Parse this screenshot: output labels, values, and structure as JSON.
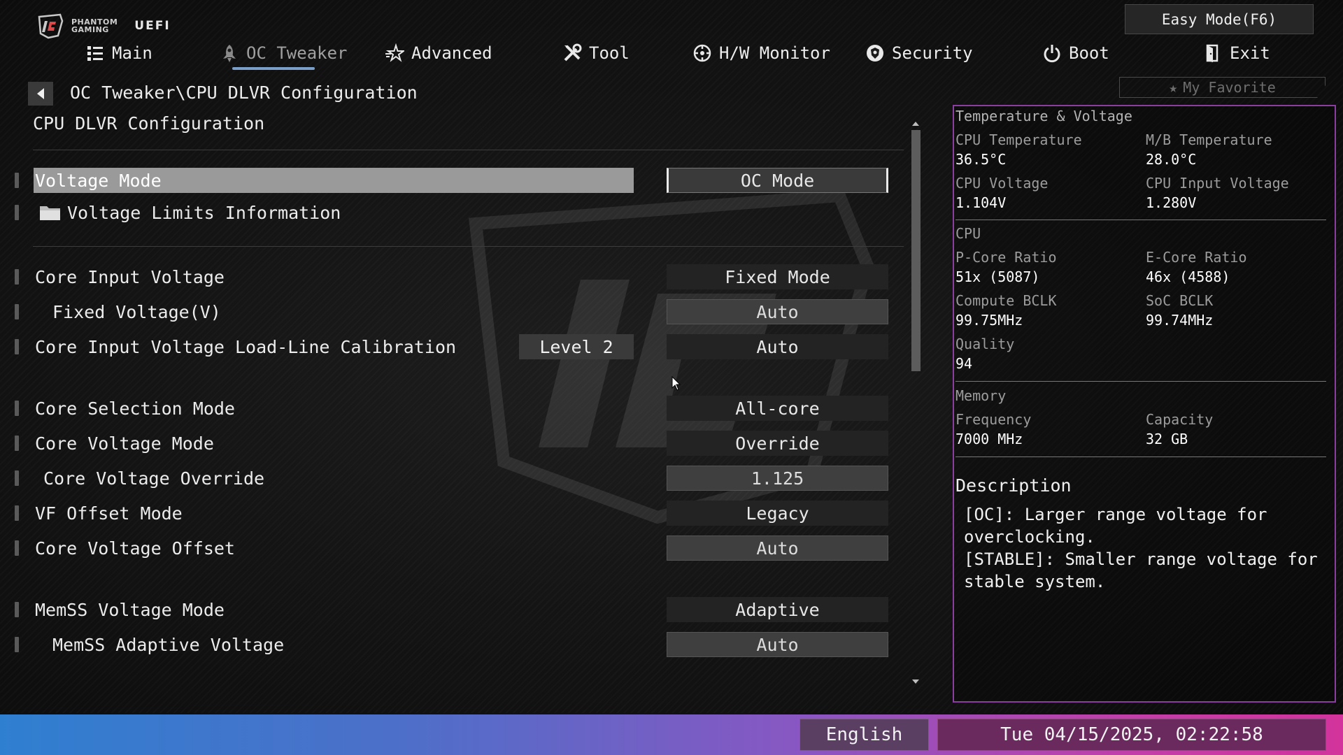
{
  "header": {
    "brand_line1": "PHANTOM",
    "brand_line2": "GAMING",
    "brand_uefi": "UEFI",
    "easy_mode": "Easy Mode(F6)",
    "my_favorite": "My Favorite"
  },
  "tabs": [
    {
      "label": "Main",
      "icon": "list-icon"
    },
    {
      "label": "OC Tweaker",
      "icon": "rocket-icon",
      "active": true
    },
    {
      "label": "Advanced",
      "icon": "star-icon"
    },
    {
      "label": "Tool",
      "icon": "tools-icon"
    },
    {
      "label": "H/W Monitor",
      "icon": "monitor-icon"
    },
    {
      "label": "Security",
      "icon": "shield-icon"
    },
    {
      "label": "Boot",
      "icon": "power-icon"
    },
    {
      "label": "Exit",
      "icon": "exit-icon"
    }
  ],
  "breadcrumb": "OC Tweaker\\CPU DLVR Configuration",
  "page_title": "CPU DLVR Configuration",
  "settings": [
    {
      "label": "Voltage Mode",
      "value": "OC Mode"
    },
    {
      "label": "Voltage Limits Information"
    },
    {
      "label": "Core Input Voltage",
      "value": "Fixed Mode"
    },
    {
      "label": "Fixed Voltage(V)",
      "value": "Auto"
    },
    {
      "label": "Core Input Voltage Load-Line Calibration",
      "hint": "Level 2",
      "value": "Auto"
    },
    {
      "label": "Core Selection Mode",
      "value": "All-core"
    },
    {
      "label": "Core Voltage Mode",
      "value": "Override"
    },
    {
      "label": "Core Voltage Override",
      "value": "1.125"
    },
    {
      "label": "VF Offset Mode",
      "value": "Legacy"
    },
    {
      "label": "Core Voltage Offset",
      "value": "Auto"
    },
    {
      "label": "MemSS Voltage Mode",
      "value": "Adaptive"
    },
    {
      "label": "MemSS Adaptive Voltage",
      "value": "Auto"
    }
  ],
  "panel": {
    "title": "Temperature & Voltage",
    "cpu_temp_label": "CPU Temperature",
    "cpu_temp": "36.5°C",
    "mb_temp_label": "M/B Temperature",
    "mb_temp": "28.0°C",
    "cpu_voltage_label": "CPU Voltage",
    "cpu_voltage": "1.104V",
    "cpu_input_voltage_label": "CPU Input Voltage",
    "cpu_input_voltage": "1.280V",
    "cpu_section": "CPU",
    "pcore_label": "P-Core Ratio",
    "pcore": "51x (5087)",
    "ecore_label": "E-Core Ratio",
    "ecore": "46x (4588)",
    "compute_bclk_label": "Compute BCLK",
    "compute_bclk": "99.75MHz",
    "soc_bclk_label": "SoC BCLK",
    "soc_bclk": "99.74MHz",
    "quality_label": "Quality",
    "quality": "94",
    "memory_section": "Memory",
    "frequency_label": "Frequency",
    "frequency": "7000 MHz",
    "capacity_label": "Capacity",
    "capacity": "32 GB",
    "description_title": "Description",
    "description_text": "[OC]: Larger range voltage for\noverclocking.\n[STABLE]: Smaller range voltage for\nstable system."
  },
  "footer": {
    "language": "English",
    "datetime": "Tue 04/15/2025, 02:22:58"
  },
  "colors": {
    "accent_underline": "#7a9fc9",
    "panel_border": "#8a3fa0",
    "footer_start": "#2f7fd0",
    "footer_end": "#d2339c",
    "selected_row": "#9a9a9a"
  }
}
